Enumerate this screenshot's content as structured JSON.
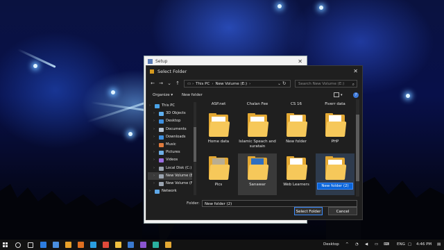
{
  "setup_window": {
    "title": "Setup"
  },
  "dialog": {
    "title": "Select Folder",
    "breadcrumb": [
      "This PC",
      "New Volume (E:)"
    ],
    "search_placeholder": "Search New Volume (E:)",
    "commands": {
      "organize": "Organize ▾",
      "new_folder": "New folder"
    },
    "nav_tree": [
      {
        "label": "This PC",
        "icon": "computer-icon",
        "color": "#4aa3e8"
      },
      {
        "label": "3D Objects",
        "icon": "cube-icon",
        "color": "#5fb0f0"
      },
      {
        "label": "Desktop",
        "icon": "desktop-icon",
        "color": "#3d8fe0"
      },
      {
        "label": "Documents",
        "icon": "document-icon",
        "color": "#b7c4d4"
      },
      {
        "label": "Downloads",
        "icon": "download-icon",
        "color": "#3d8fe0"
      },
      {
        "label": "Music",
        "icon": "music-icon",
        "color": "#e07b3d"
      },
      {
        "label": "Pictures",
        "icon": "pictures-icon",
        "color": "#6fb0e8"
      },
      {
        "label": "Videos",
        "icon": "video-icon",
        "color": "#9a6de0"
      },
      {
        "label": "Local Disk (C:)",
        "icon": "drive-icon",
        "color": "#9aa4b0"
      },
      {
        "label": "New Volume (E:)",
        "icon": "drive-icon",
        "color": "#9aa4b0"
      },
      {
        "label": "New Volume (F:)",
        "icon": "drive-icon",
        "color": "#9aa4b0"
      },
      {
        "label": "Network",
        "icon": "network-icon",
        "color": "#5fa8e8"
      }
    ],
    "files_top_row": [
      "ASP.net",
      "Chalan Fee",
      "CS 16",
      "Fiverr data"
    ],
    "files": [
      {
        "label": "Home data",
        "thumb": "plain"
      },
      {
        "label": "Islamic Speach and suratain",
        "thumb": "plain"
      },
      {
        "label": "New folder",
        "thumb": "document"
      },
      {
        "label": "PHP",
        "thumb": "document-red"
      },
      {
        "label": "Pics",
        "thumb": "photo"
      },
      {
        "label": "Sanawar",
        "thumb": "blue-doc"
      },
      {
        "label": "Web Learners",
        "thumb": "document-orange"
      },
      {
        "label": "New folder (2)",
        "thumb": "plain"
      }
    ],
    "folder_label": "Folder:",
    "folder_value": "New folder (2)",
    "select_button": "Select Folder",
    "cancel_button": "Cancel"
  },
  "taskbar": {
    "desktop_label": "Desktop",
    "language": "ENG",
    "time": "4:46 PM",
    "pinned_icons": [
      {
        "name": "search-icon",
        "color": "#dddddd"
      },
      {
        "name": "task-view-icon",
        "color": "#dddddd"
      },
      {
        "name": "store-icon",
        "color": "#2d7de0"
      },
      {
        "name": "mail-icon",
        "color": "#4a8fe0"
      },
      {
        "name": "browser-icon",
        "color": "#e8a12a"
      },
      {
        "name": "media-player-icon",
        "color": "#e07020"
      },
      {
        "name": "edge-icon",
        "color": "#2a9fe0"
      },
      {
        "name": "chrome-icon",
        "color": "#e04a3a"
      },
      {
        "name": "file-explorer-icon",
        "color": "#f0c040"
      },
      {
        "name": "terminal-icon",
        "color": "#3a7ad0"
      },
      {
        "name": "visual-studio-icon",
        "color": "#8a55d0"
      },
      {
        "name": "photos-icon",
        "color": "#2ab0a0"
      },
      {
        "name": "folder-app-icon",
        "color": "#e3a833"
      }
    ]
  }
}
